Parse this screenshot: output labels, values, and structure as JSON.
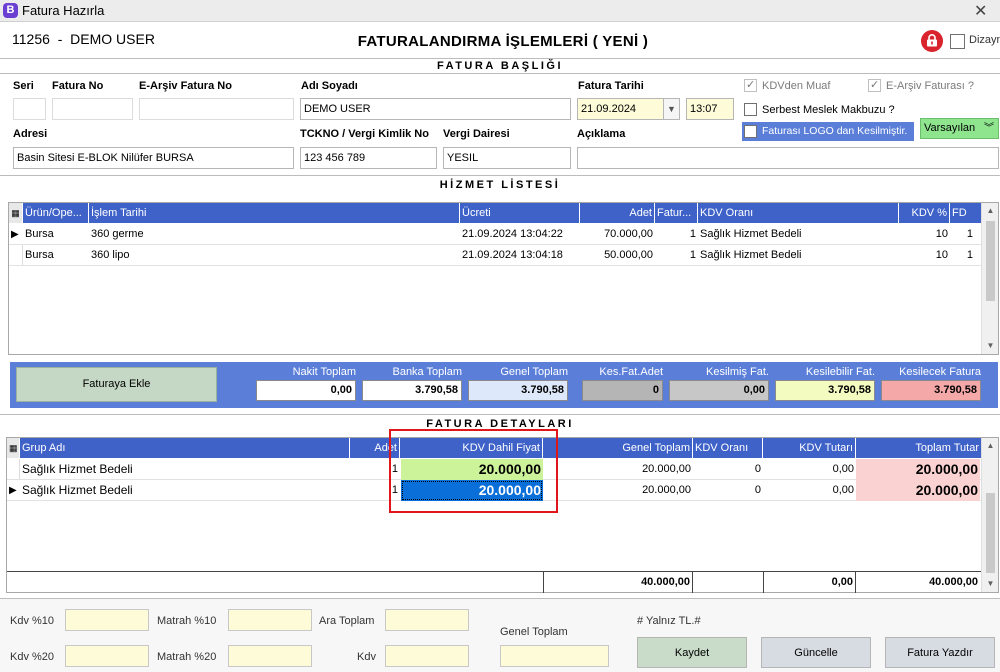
{
  "window": {
    "title": "Fatura Hazırla",
    "app_icon_letter": "B",
    "close_glyph": "✕"
  },
  "header": {
    "code": "11256",
    "separator": "-",
    "user": "DEMO USER",
    "title": "FATURALANDIRMA İŞLEMLERİ ( YENİ )",
    "dizayn_label": "Dizayn"
  },
  "fatura_basligi": {
    "section_title": "FATURA BAŞLIĞI",
    "seri_label": "Seri",
    "seri_value": "",
    "fatura_no_label": "Fatura No",
    "fatura_no_value": "",
    "earsiv_no_label": "E-Arşiv Fatura No",
    "earsiv_no_value": "",
    "adi_soyadi_label": "Adı Soyadı",
    "adi_soyadi_value": "DEMO USER",
    "fatura_tarihi_label": "Fatura Tarihi",
    "fatura_tarihi_value": "21.09.2024",
    "fatura_saat_value": "13:07",
    "kdv_muaf_label": "KDVden Muaf",
    "kdv_muaf_checked": true,
    "earsiv_faturasi_label": "E-Arşiv Faturası ?",
    "earsiv_faturasi_checked": true,
    "serbest_meslek_label": "Serbest Meslek Makbuzu ?",
    "logo_label": "Faturası LOGO dan Kesilmiştir.",
    "varsayilan_label": "Varsayılan",
    "adresi_label": "Adresi",
    "adresi_value": "Basin Sitesi E-BLOK Nilüfer BURSA",
    "tckno_label": "TCKNO / Vergi Kimlik No",
    "tckno_value": "123 456 789",
    "vergi_dairesi_label": "Vergi Dairesi",
    "vergi_dairesi_value": "YESIL",
    "aciklama_label": "Açıklama",
    "aciklama_value": ""
  },
  "hizmet_listesi": {
    "section_title": "HİZMET LİSTESİ",
    "columns": [
      "Ürün/Ope...",
      "İşlem Tarihi",
      "Ücreti",
      "Adet",
      "Fatur...",
      "KDV Oranı",
      "KDV %",
      "FD"
    ],
    "rows": [
      {
        "urun": "Bursa",
        "islem": "360 germe",
        "tarih": "21.09.2024 13:04:22",
        "adet": "70.000,00",
        "fatur": "1",
        "kdv_orani": "Sağlık Hizmet Bedeli",
        "kdv_yuzde": "10",
        "fd": "1"
      },
      {
        "urun": "Bursa",
        "islem": "360 lipo",
        "tarih": "21.09.2024 13:04:18",
        "adet": "50.000,00",
        "fatur": "1",
        "kdv_orani": "Sağlık Hizmet Bedeli",
        "kdv_yuzde": "10",
        "fd": "1"
      }
    ]
  },
  "totals": {
    "faturaya_ekle": "Faturaya Ekle",
    "nakit_label": "Nakit Toplam",
    "nakit_value": "0,00",
    "banka_label": "Banka Toplam",
    "banka_value": "3.790,58",
    "genel_label": "Genel Toplam",
    "genel_value": "3.790,58",
    "kes_adet_label": "Kes.Fat.Adet",
    "kes_adet_value": "0",
    "kesilmis_label": "Kesilmiş Fat.",
    "kesilmis_value": "0,00",
    "kesilebilir_label": "Kesilebilir Fat.",
    "kesilebilir_value": "3.790,58",
    "kesilecek_label": "Kesilecek Fatura",
    "kesilecek_value": "3.790,58",
    "colors": {
      "genel": "#dde8fb",
      "kes_adet": "#b5b5b5",
      "kesilmis": "#c7c7c7",
      "kesilebilir": "#f3fbc0",
      "kesilecek": "#f4a8a8"
    }
  },
  "fatura_detaylari": {
    "section_title": "FATURA DETAYLARI",
    "columns": [
      "Grup Adı",
      "Adet",
      "KDV Dahil Fiyat",
      "Genel Toplam",
      "KDV Oranı",
      "KDV Tutarı",
      "Toplam Tutar"
    ],
    "rows": [
      {
        "grup": "Sağlık Hizmet Bedeli",
        "adet": "1",
        "fiyat": "20.000,00",
        "genel": "20.000,00",
        "kdv_orani": "0",
        "kdv_tutari": "0,00",
        "toplam": "20.000,00"
      },
      {
        "grup": "Sağlık Hizmet Bedeli",
        "adet": "1",
        "fiyat": "20.000,00",
        "genel": "20.000,00",
        "kdv_orani": "0",
        "kdv_tutari": "0,00",
        "toplam": "20.000,00"
      }
    ],
    "footer": {
      "genel": "40.000,00",
      "kdv_tutari": "0,00",
      "toplam": "40.000,00"
    }
  },
  "bottom": {
    "kdv10_label": "Kdv %10",
    "matrah10_label": "Matrah %10",
    "ara_toplam_label": "Ara Toplam",
    "kdv20_label": "Kdv %20",
    "matrah20_label": "Matrah %20",
    "kdv_label": "Kdv",
    "genel_toplam_label": "Genel Toplam",
    "yalniz_label": "# Yalnız TL.#",
    "kaydet": "Kaydet",
    "guncelle": "Güncelle",
    "fatura_yazdir": "Fatura Yazdır"
  }
}
